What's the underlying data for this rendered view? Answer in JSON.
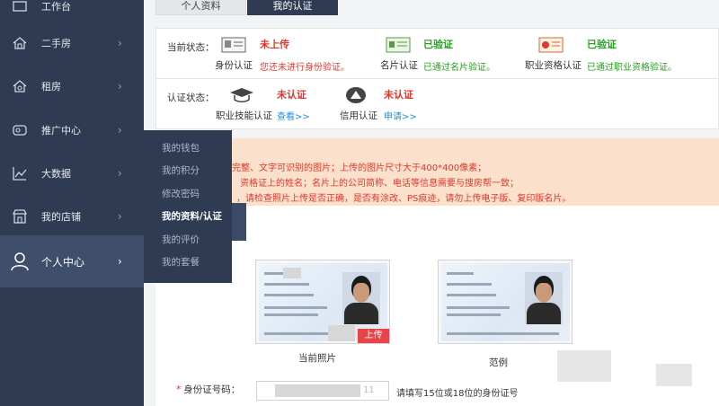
{
  "sidebar": {
    "items": [
      {
        "label": "工作台",
        "icon": "desk-icon"
      },
      {
        "label": "二手房",
        "icon": "house-icon"
      },
      {
        "label": "租房",
        "icon": "rent-icon"
      },
      {
        "label": "推广中心",
        "icon": "promotion-icon"
      },
      {
        "label": "大数据",
        "icon": "chart-icon"
      },
      {
        "label": "我的店铺",
        "icon": "store-icon"
      },
      {
        "label": "个人中心",
        "icon": "user-icon"
      }
    ],
    "chevron": "›"
  },
  "submenu": {
    "items": [
      "我的钱包",
      "我的积分",
      "修改密码",
      "我的资料/认证",
      "我的评价",
      "我的套餐"
    ]
  },
  "tabs": {
    "profile": "个人资料",
    "verification": "我的认证"
  },
  "current_status": {
    "label": "当前状态：",
    "certs": [
      {
        "name": "身份认证",
        "status": "未上传",
        "hint": "您还未进行身份验证。",
        "color": "#e0382c"
      },
      {
        "name": "名片认证",
        "status": "已验证",
        "hint": "已通过名片验证。",
        "color": "#26a11e"
      },
      {
        "name": "职业资格认证",
        "status": "已验证",
        "hint": "已通过职业资格验证。",
        "color": "#26a11e"
      }
    ]
  },
  "auth_status": {
    "label": "认证状态：",
    "certs": [
      {
        "name": "职业技能认证",
        "status": "未认证",
        "action": "查看>>"
      },
      {
        "name": "信用认证",
        "status": "未认证",
        "action": "申请>>"
      }
    ]
  },
  "notice": {
    "lines": [
      "完整、文字可识别的图片；上传的图片尺寸大于400*400像素；",
      "资格证上的姓名；名片上的公司简称、电话等信息需要与搜房帮一致；",
      "，请检查照片上传是否正确，是否有涂改、PS痕迹，请勿上传电子版、复印版名片。"
    ]
  },
  "photos": {
    "current_caption": "当前照片",
    "example_caption": "范例",
    "upload_label": "上传",
    "card_fields": [
      "姓名",
      "性别",
      "出生",
      "住址",
      "公民身份号码"
    ],
    "card_values": [
      "男",
      "汉",
      "1983 年 8 月 25 日",
      "河南省孟州市新郑镇缘坊",
      "村委开张 3 5 号"
    ]
  },
  "form": {
    "id_label": "身份证号码：",
    "required_mark": "*",
    "id_value_tail": "11",
    "tip": "请填写15位或18位的身份证号"
  }
}
